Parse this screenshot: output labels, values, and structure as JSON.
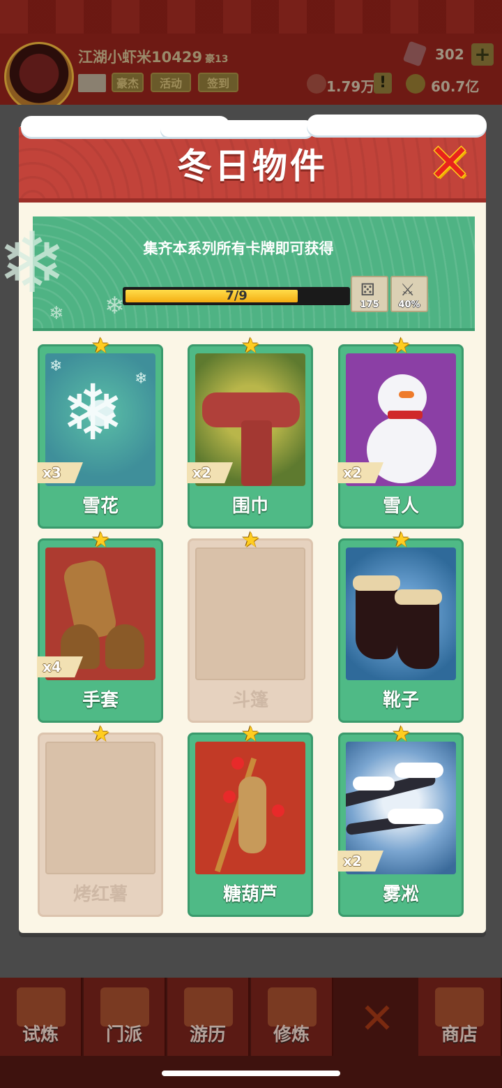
{
  "player": {
    "name": "江湖小虾米10429",
    "rank": "豪13",
    "buttons": [
      "豪杰",
      "活动",
      "签到"
    ]
  },
  "resources": {
    "gems": "302",
    "power": "1.79万",
    "gold": "60.7亿"
  },
  "dialog": {
    "title": "冬日物件",
    "banner_text": "集齐本系列所有卡牌即可获得",
    "progress": {
      "label": "7/9",
      "fraction": 0.778
    },
    "rewards": [
      {
        "icon": "dice-icon",
        "value": "175"
      },
      {
        "icon": "sword-icon",
        "value": "40%"
      }
    ],
    "cards": [
      {
        "name": "雪花",
        "count": "x3",
        "collected": true,
        "art": "snowflake"
      },
      {
        "name": "围巾",
        "count": "x2",
        "collected": true,
        "art": "scarf"
      },
      {
        "name": "雪人",
        "count": "x2",
        "collected": true,
        "art": "snowman"
      },
      {
        "name": "手套",
        "count": "x4",
        "collected": true,
        "art": "gloves"
      },
      {
        "name": "斗篷",
        "count": "",
        "collected": false,
        "art": "empty"
      },
      {
        "name": "靴子",
        "count": "",
        "collected": true,
        "art": "boots"
      },
      {
        "name": "烤红薯",
        "count": "",
        "collected": false,
        "art": "empty"
      },
      {
        "name": "糖葫芦",
        "count": "",
        "collected": true,
        "art": "tanghulu"
      },
      {
        "name": "雾凇",
        "count": "x2",
        "collected": true,
        "art": "rime"
      }
    ]
  },
  "nav": {
    "items": [
      "试炼",
      "门派",
      "游历",
      "修炼",
      "",
      "商店"
    ]
  },
  "colors": {
    "header_red": "#c2433a",
    "card_green": "#4fba86",
    "star_yellow": "#ffcd20",
    "close_red": "#e8231c"
  }
}
